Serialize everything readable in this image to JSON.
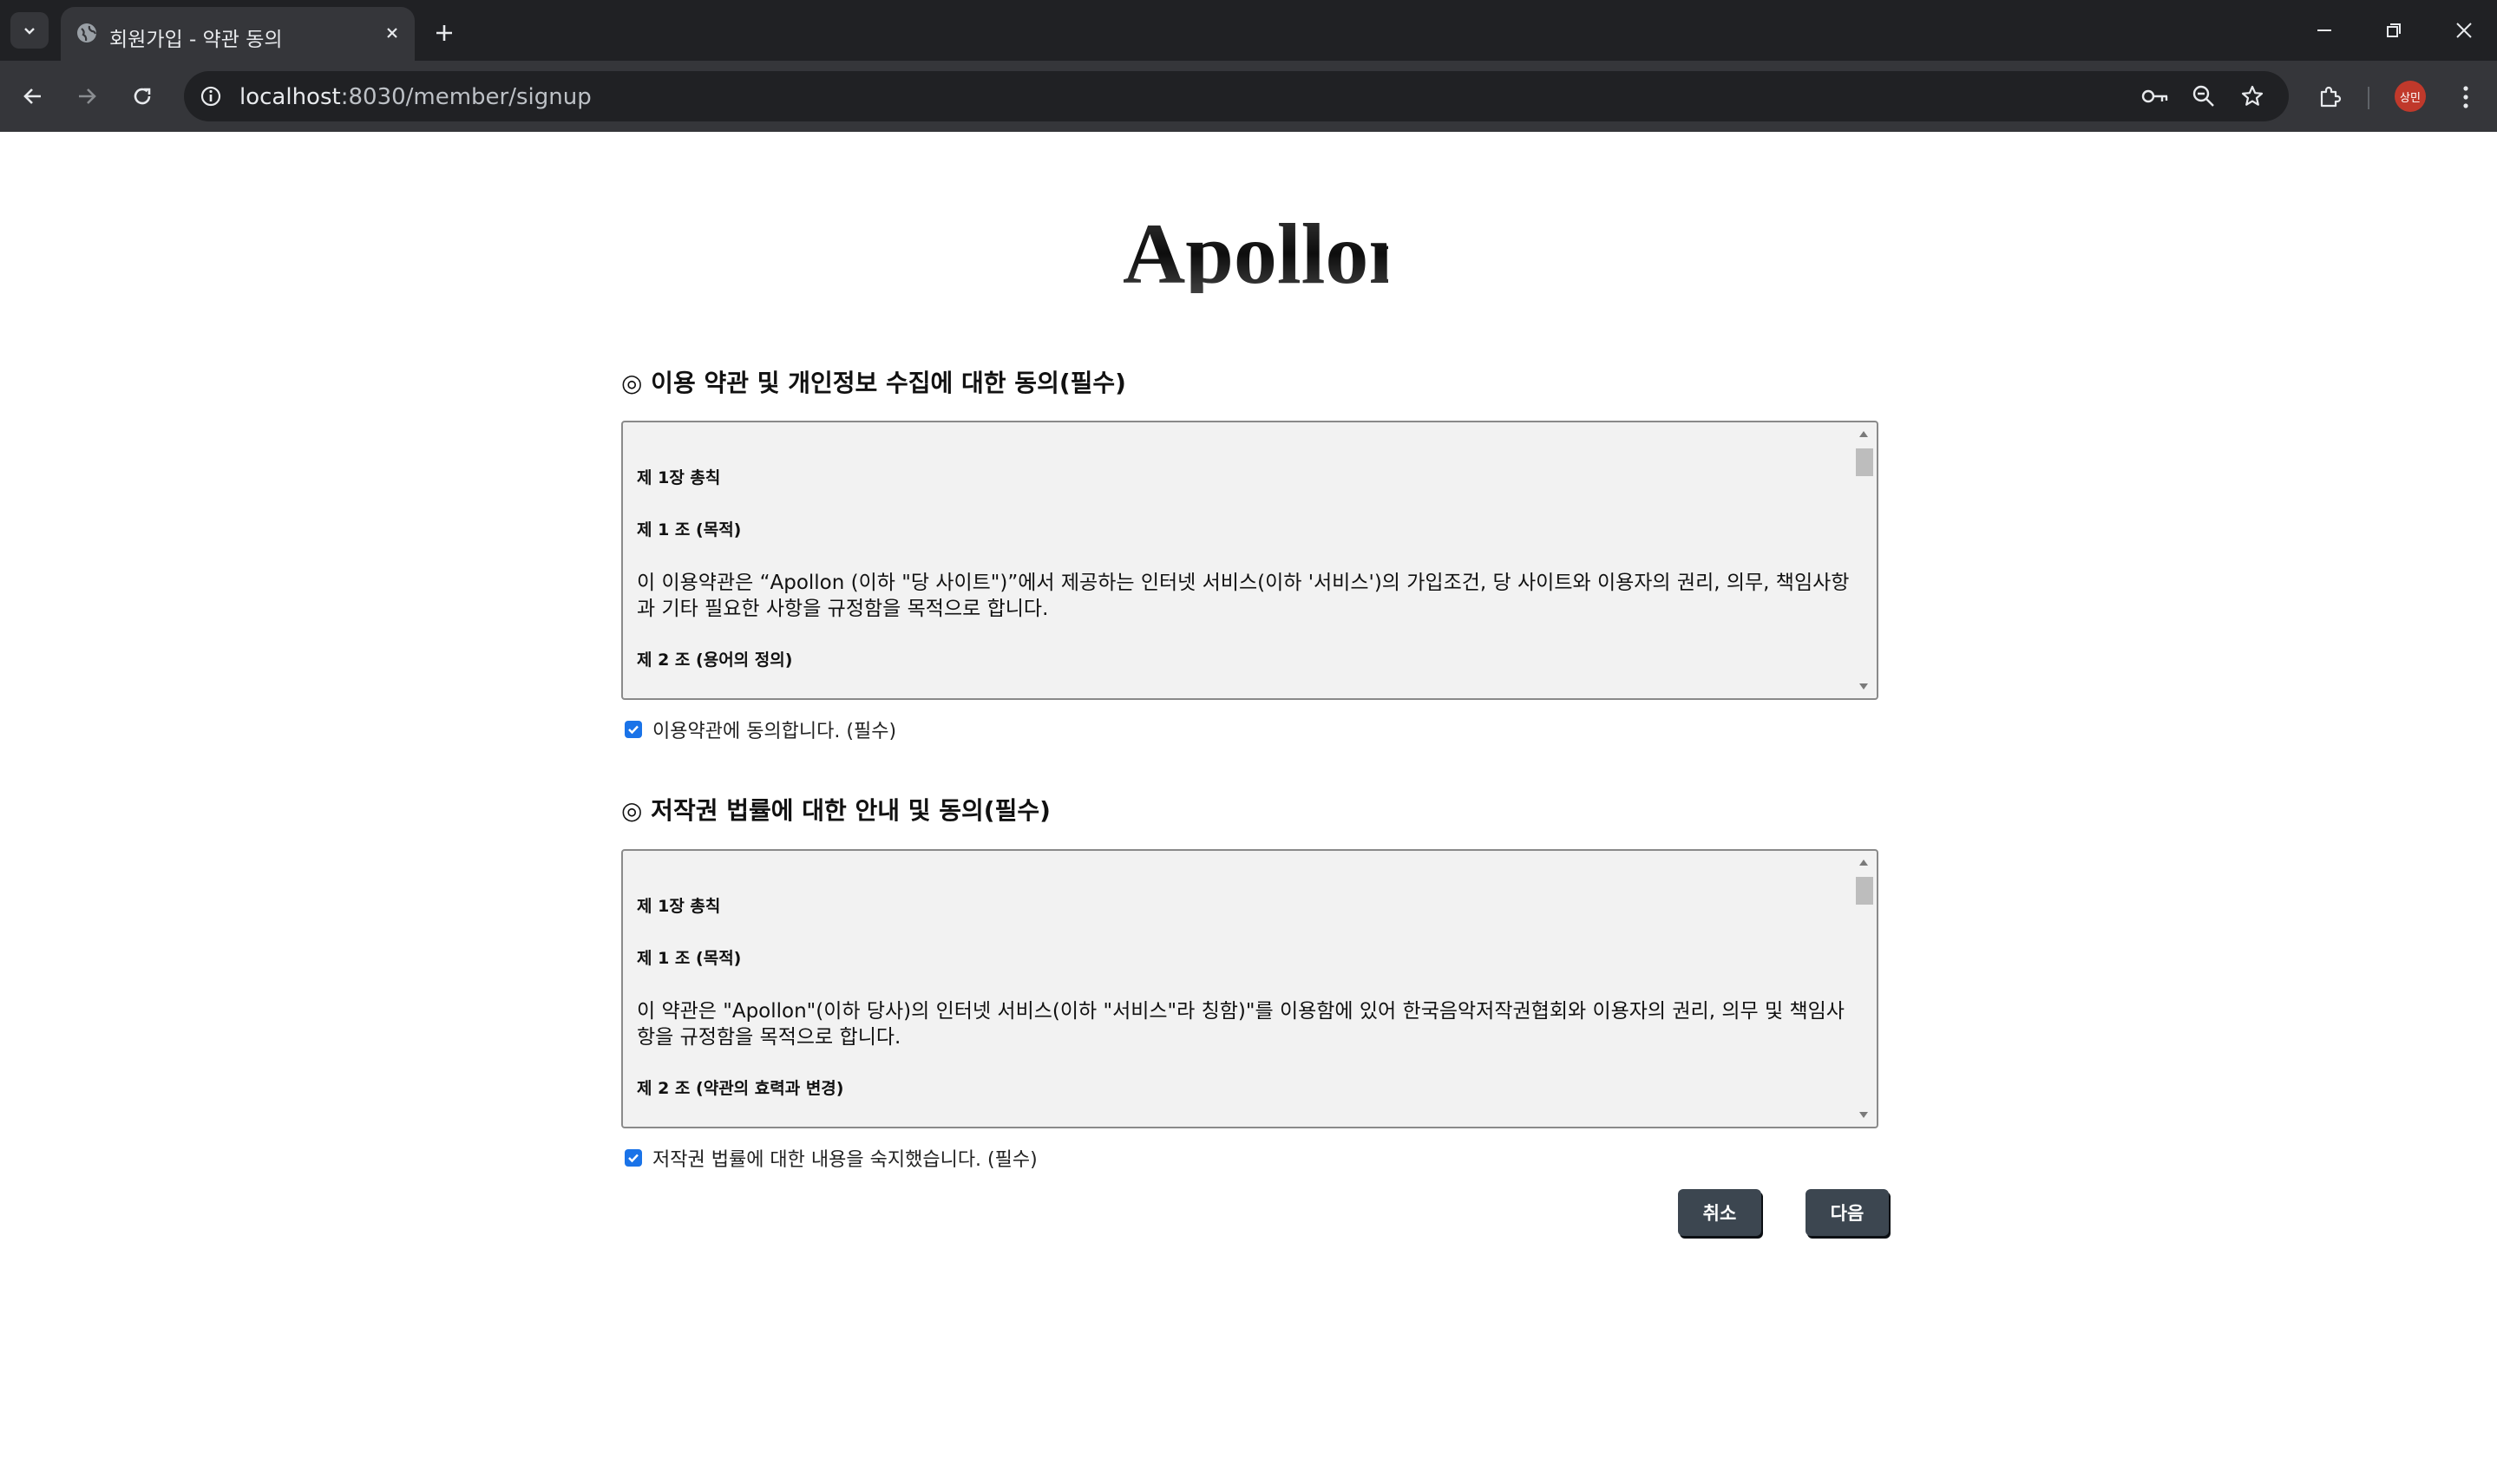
{
  "browser": {
    "tab_title": "회원가입 - 약관 동의",
    "url_host": "localhost",
    "url_path": ":8030/member/signup",
    "profile_label": "상민",
    "icons": [
      "tab-search-icon",
      "globe-icon",
      "close-icon",
      "plus-icon",
      "minimize-icon",
      "restore-icon",
      "back-arrow-icon",
      "forward-arrow-icon",
      "reload-icon",
      "site-info-icon",
      "password-key-icon",
      "zoom-icon",
      "bookmark-star-icon",
      "extensions-icon",
      "kebab-menu-icon"
    ]
  },
  "page": {
    "logo_text": "Apollon",
    "terms": {
      "title": "◎ 이용 약관 및 개인정보 수집에 대한 동의(필수)",
      "chapter": "제 1장 총칙",
      "article1": "제 1 조 (목적)",
      "paragraph": "이 이용약관은 “Apollon (이하 \"당 사이트\")”에서 제공하는 인터넷 서비스(이하 '서비스')의 가입조건, 당 사이트와 이용자의 권리, 의무, 책임사항과 기타 필요한 사항을 규정함을 목적으로 합니다.",
      "article2": "제 2 조 (용어의 정의)",
      "agree_label": "이용약관에 동의합니다. (필수)",
      "checked": true
    },
    "copyright": {
      "title": "◎ 저작권 법률에 대한 안내 및 동의(필수)",
      "chapter": "제 1장 총칙",
      "article1": "제 1 조 (목적)",
      "paragraph": "이 약관은 \"Apollon\"(이하 당사)의 인터넷 서비스(이하 \"서비스\"라 칭함)\"를 이용함에 있어 한국음악저작권협회와 이용자의 권리, 의무 및 책임사항을 규정함을 목적으로 합니다.",
      "article2": "제 2 조 (약관의 효력과 변경)",
      "agree_label": "저작권 법률에 대한 내용을 숙지했습니다. (필수)",
      "checked": true
    },
    "buttons": {
      "cancel": "취소",
      "next": "다음"
    },
    "colors": {
      "button_bg": "#3c4650",
      "checkbox": "#1a73e8",
      "terms_bg": "#f2f2f2"
    }
  }
}
